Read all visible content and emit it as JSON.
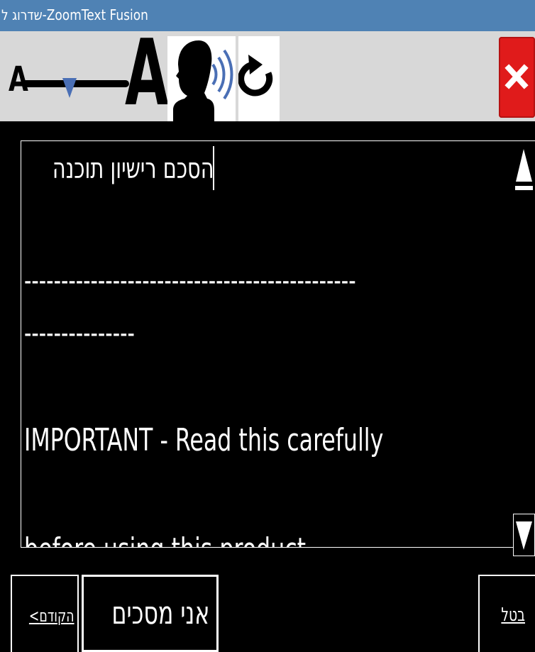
{
  "window": {
    "title": "שדרוג ל-ZoomText Fusion"
  },
  "toolbar": {
    "font_size_small_label": "A",
    "font_size_large_label": "A",
    "speech_button": "speech",
    "refresh_button": "refresh",
    "close_button": "close",
    "slider_accent_color": "#4a6fb5",
    "close_color": "#e01b1b"
  },
  "document": {
    "lines": [
      "הסכם רישיון תוכנה",
      "---------------------------------------------",
      "---------------",
      "IMPORTANT - Read this carefully",
      "before using this product"
    ]
  },
  "footer": {
    "prev_label": "<הקודם",
    "agree_label": "אני מסכים",
    "cancel_label": "בטל"
  }
}
